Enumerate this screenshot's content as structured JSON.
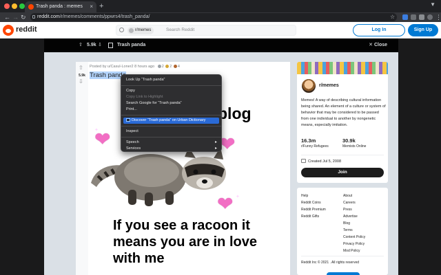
{
  "browser": {
    "tab_title": "Trash panda : memes",
    "url_domain": "reddit.com",
    "url_path": "/r/memes/comments/ppwrs4/trash_panda/",
    "close_glyph": "×",
    "new_tab_glyph": "+",
    "colors": {
      "red": "#ff5f57",
      "yellow": "#febc2e",
      "green": "#28c840"
    }
  },
  "header": {
    "logo_text": "reddit",
    "search_chip": "r/memes",
    "search_placeholder": "Search Reddit",
    "login_label": "Log In",
    "signup_label": "Sign Up",
    "accent": "#0079d3",
    "brand": "#ff4500"
  },
  "post_bar": {
    "score": "5.9k",
    "title": "Trash panda",
    "close_label": "Close"
  },
  "post": {
    "score": "5.9k",
    "meta": "Posted by u/Casul-Loner2 8 hours ago",
    "award_counts": [
      "2",
      "2",
      "4"
    ],
    "title": "Trash panda",
    "title_selected": "Trash panda",
    "meme_top_word": "blog",
    "meme_caption_lines": [
      "If you see a racoon it",
      "means you are in love",
      "with me"
    ]
  },
  "context_menu": {
    "items": [
      {
        "label": "Look Up “Trash panda”",
        "state": "normal"
      },
      {
        "sep": true
      },
      {
        "label": "Copy",
        "state": "normal"
      },
      {
        "label": "Copy Link to Highlight",
        "state": "disabled"
      },
      {
        "label": "Search Google for “Trash panda”",
        "state": "normal"
      },
      {
        "label": "Print...",
        "state": "normal"
      },
      {
        "sep": true
      },
      {
        "label": "Discover “Trash panda” on Urban Dictionary",
        "state": "highlighted"
      },
      {
        "sep": true
      },
      {
        "label": "Inspect",
        "state": "normal"
      },
      {
        "sep": true
      },
      {
        "label": "Speech",
        "state": "submenu"
      },
      {
        "label": "Services",
        "state": "submenu"
      }
    ]
  },
  "sidebar": {
    "name": "r/memes",
    "description": "Memes! A way of describing cultural information being shared. An element of a culture or system of behavior that may be considered to be passed from one individual to another by nongenetic means, especially imitation.",
    "members_count": "16.3m",
    "members_label": "r/Funny Refugees",
    "online_count": "30.9k",
    "online_label": "Memists Online",
    "created": "Created Jul 5, 2008",
    "join_label": "Join"
  },
  "footer": {
    "left_links": [
      "Help",
      "Reddit Coins",
      "Reddit Premium",
      "Reddit Gifts"
    ],
    "right_links": [
      "About",
      "Careers",
      "Press",
      "Advertise",
      "Blog",
      "Terms",
      "Content Policy",
      "Privacy Policy",
      "Mod Policy"
    ],
    "copyright": "Reddit Inc © 2021 . All rights reserved"
  }
}
